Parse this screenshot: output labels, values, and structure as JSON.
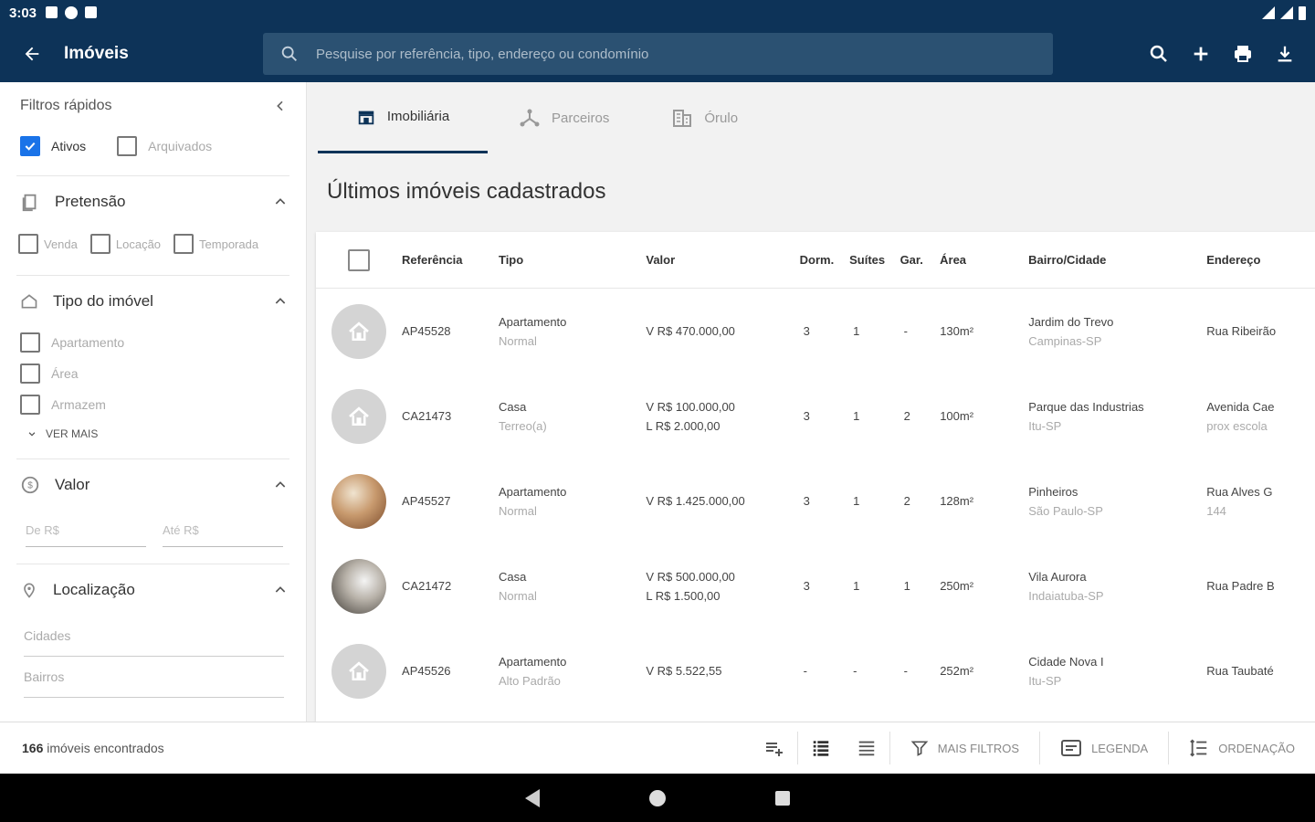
{
  "status": {
    "time": "3:03"
  },
  "appbar": {
    "title": "Imóveis",
    "search_placeholder": "Pesquise por referência, tipo, endereço ou condomínio"
  },
  "sidebar": {
    "quick_filters_title": "Filtros rápidos",
    "quick": [
      {
        "label": "Ativos",
        "checked": true
      },
      {
        "label": "Arquivados",
        "checked": false
      }
    ],
    "pretensao": {
      "title": "Pretensão",
      "options": [
        "Venda",
        "Locação",
        "Temporada"
      ]
    },
    "tipo": {
      "title": "Tipo do imóvel",
      "options": [
        "Apartamento",
        "Área",
        "Armazem"
      ],
      "ver_mais": "VER MAIS"
    },
    "valor": {
      "title": "Valor",
      "from_placeholder": "De R$",
      "to_placeholder": "Até R$"
    },
    "localizacao": {
      "title": "Localização",
      "cidades_placeholder": "Cidades",
      "bairros_placeholder": "Bairros"
    }
  },
  "tabs": [
    {
      "label": "Imobiliária",
      "icon": "store-icon"
    },
    {
      "label": "Parceiros",
      "icon": "network-icon"
    },
    {
      "label": "Órulo",
      "icon": "building-icon"
    }
  ],
  "main_title": "Últimos imóveis cadastrados",
  "table": {
    "headers": {
      "ref": "Referência",
      "tipo": "Tipo",
      "valor": "Valor",
      "dorm": "Dorm.",
      "suites": "Suítes",
      "gar": "Gar.",
      "area": "Área",
      "bairro": "Bairro/Cidade",
      "endereco": "Endereço"
    },
    "rows": [
      {
        "ref": "AP45528",
        "tipo": "Apartamento",
        "subtipo": "Normal",
        "valor1": "V R$ 470.000,00",
        "valor2": "",
        "dorm": "3",
        "suites": "1",
        "gar": "-",
        "area": "130m²",
        "bairro": "Jardim do Trevo",
        "cidade": "Campinas-SP",
        "endereco": "Rua Ribeirão",
        "endereco2": "",
        "thumb": "placeholder"
      },
      {
        "ref": "CA21473",
        "tipo": "Casa",
        "subtipo": "Terreo(a)",
        "valor1": "V R$ 100.000,00",
        "valor2": "L R$ 2.000,00",
        "dorm": "3",
        "suites": "1",
        "gar": "2",
        "area": "100m²",
        "bairro": "Parque das Industrias",
        "cidade": "Itu-SP",
        "endereco": "Avenida Cae",
        "endereco2": "prox escola",
        "thumb": "placeholder"
      },
      {
        "ref": "AP45527",
        "tipo": "Apartamento",
        "subtipo": "Normal",
        "valor1": "V R$ 1.425.000,00",
        "valor2": "",
        "dorm": "3",
        "suites": "1",
        "gar": "2",
        "area": "128m²",
        "bairro": "Pinheiros",
        "cidade": "São Paulo-SP",
        "endereco": "Rua Alves G",
        "endereco2": "144",
        "thumb": "photo1"
      },
      {
        "ref": "CA21472",
        "tipo": "Casa",
        "subtipo": "Normal",
        "valor1": "V R$ 500.000,00",
        "valor2": "L R$ 1.500,00",
        "dorm": "3",
        "suites": "1",
        "gar": "1",
        "area": "250m²",
        "bairro": "Vila Aurora",
        "cidade": "Indaiatuba-SP",
        "endereco": "Rua Padre B",
        "endereco2": "",
        "thumb": "photo2"
      },
      {
        "ref": "AP45526",
        "tipo": "Apartamento",
        "subtipo": "Alto Padrão",
        "valor1": "V R$ 5.522,55",
        "valor2": "",
        "dorm": "-",
        "suites": "-",
        "gar": "-",
        "area": "252m²",
        "bairro": "Cidade Nova I",
        "cidade": "Itu-SP",
        "endereco": "Rua Taubaté",
        "endereco2": "",
        "thumb": "placeholder"
      }
    ]
  },
  "bottom": {
    "count": "166",
    "count_suffix": " imóveis encontrados",
    "mais_filtros": "MAIS FILTROS",
    "legenda": "LEGENDA",
    "ordenacao": "ORDENAÇÃO"
  },
  "colors": {
    "primary": "#0d3358",
    "checkbox": "#1a73e8"
  }
}
